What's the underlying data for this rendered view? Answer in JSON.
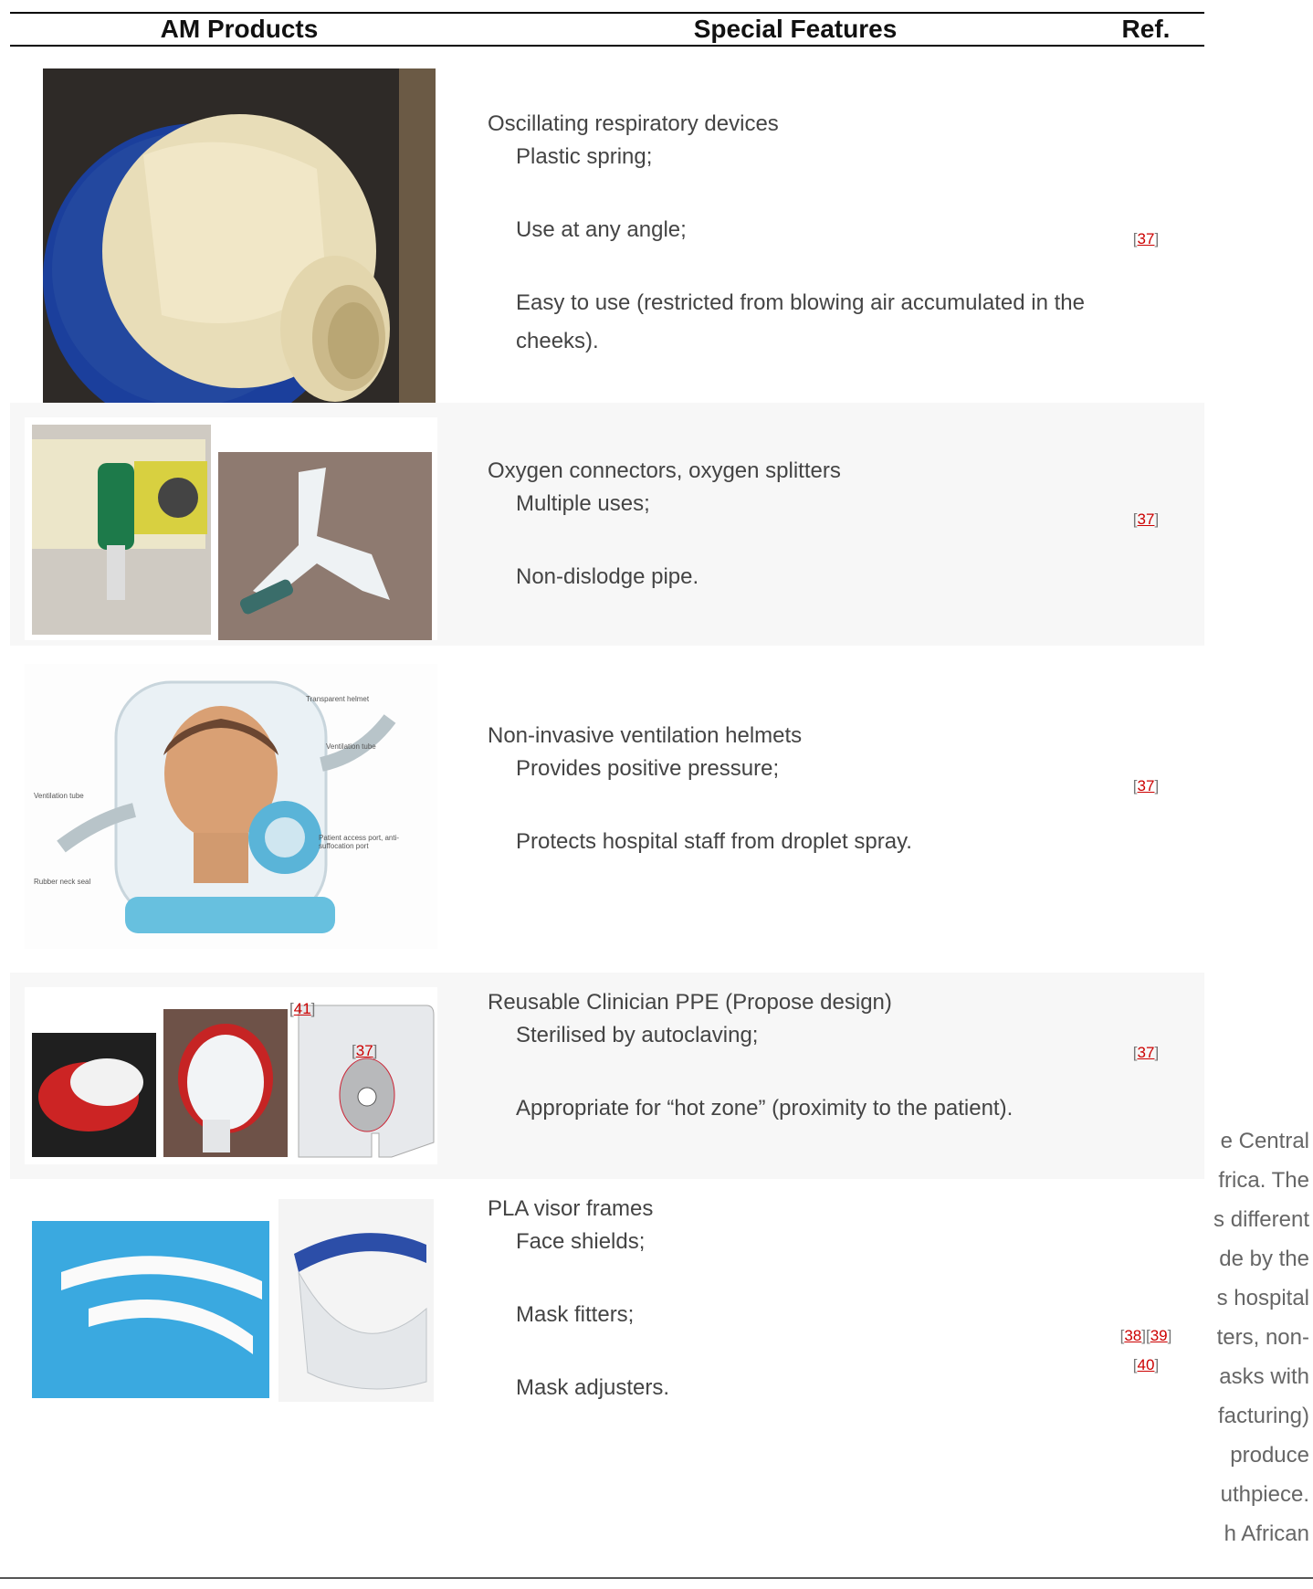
{
  "table": {
    "headers": [
      "AM Products",
      "Special Features",
      "Ref."
    ],
    "rows": [
      {
        "title": "Oscillating respiratory devices",
        "bullets": [
          "Plastic spring;",
          "Use at any angle;",
          "Easy to use (restricted from blowing air accumulated in the cheeks)."
        ],
        "refs": [
          "37"
        ]
      },
      {
        "title": "Oxygen connectors, oxygen splitters",
        "bullets": [
          "Multiple uses;",
          "Non-dislodge pipe."
        ],
        "refs": [
          "37"
        ]
      },
      {
        "title": "Non-invasive ventilation helmets",
        "bullets": [
          "Provides positive pressure;",
          "Protects hospital staff from droplet spray."
        ],
        "refs": [
          "37"
        ],
        "figure_labels": [
          "Transparent helmet",
          "Ventilation tube",
          "Ventilation tube",
          "Patient access port, anti-suffocation port",
          "Rubber neck seal"
        ]
      },
      {
        "title": "Reusable Clinician PPE (Propose design)",
        "bullets": [
          "Sterilised by autoclaving;",
          "Appropriate for “hot zone” (proximity to the patient)."
        ],
        "refs": [
          "37"
        ],
        "image_refs": [
          "41",
          "37"
        ]
      },
      {
        "title": "PLA visor frames",
        "bullets": [
          "Face shields;",
          "Mask fitters;",
          "Mask adjusters."
        ],
        "refs": [
          "38",
          "39",
          "40"
        ]
      }
    ]
  },
  "background_text": [
    "e Central",
    "frica. The",
    "s different",
    "de by the",
    "s hospital",
    "ters, non-",
    "asks with",
    "facturing)",
    "produce",
    "uthpiece.",
    "h African"
  ],
  "bullet_glyph": ""
}
